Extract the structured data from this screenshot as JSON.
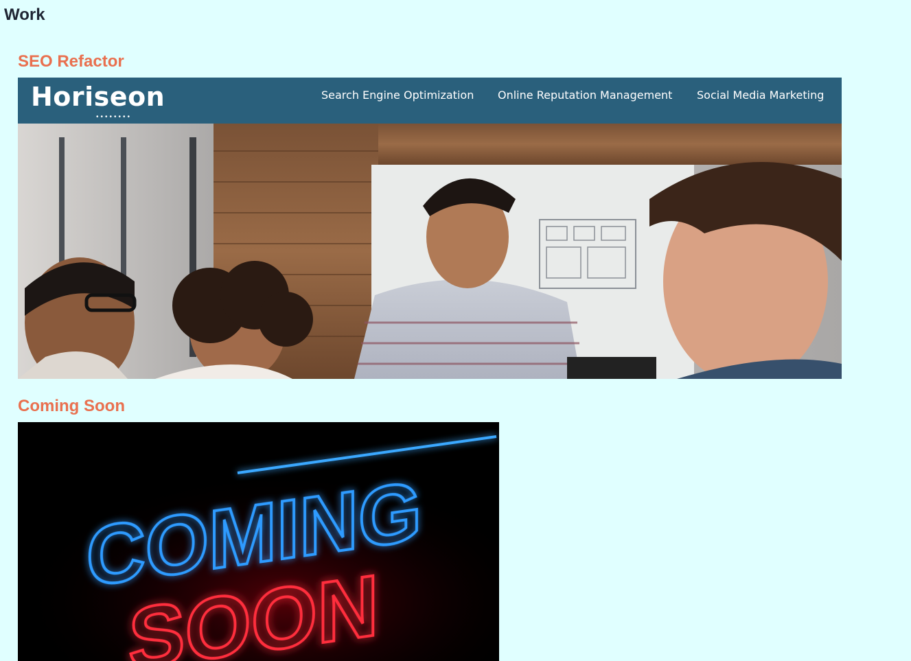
{
  "section": {
    "title": "Work"
  },
  "projects": [
    {
      "title": "SEO Refactor",
      "image": {
        "logo": "Horiseon",
        "nav": [
          "Search Engine Optimization",
          "Online Reputation Management",
          "Social Media Marketing"
        ]
      }
    },
    {
      "title": "Coming Soon",
      "image": {
        "line1": "COMING",
        "line2": "SOON"
      }
    }
  ],
  "colors": {
    "background": "#e0ffff",
    "heading": "#1e2533",
    "accent": "#e9704f",
    "header_bar": "#2a607c"
  }
}
